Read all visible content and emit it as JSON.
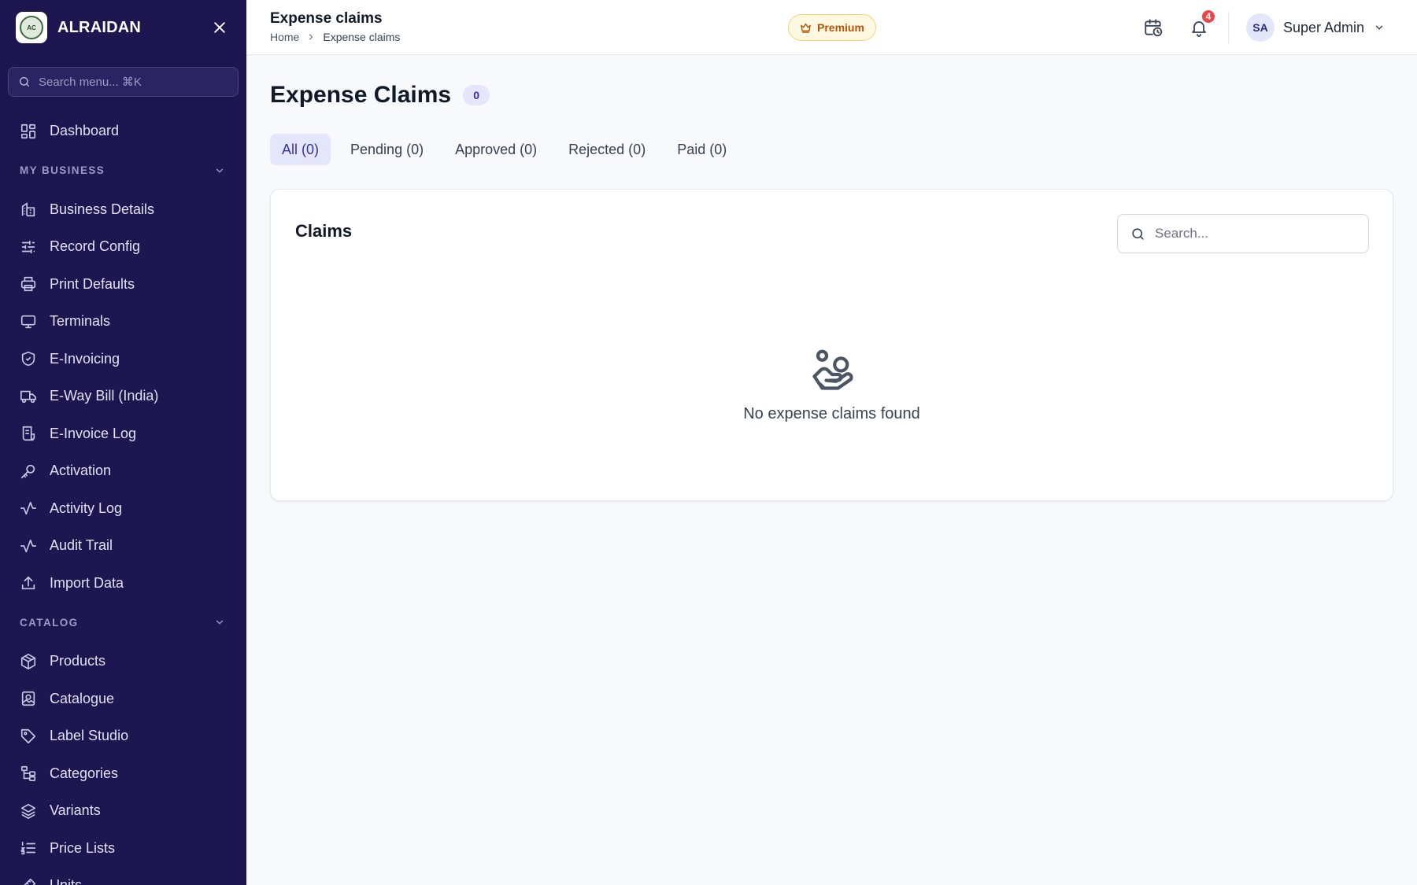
{
  "sidebar": {
    "brand": "ALRAIDAN",
    "logo_text": "AC",
    "search_placeholder": "Search menu... ⌘K",
    "dashboard": {
      "label": "Dashboard",
      "icon": "dashboard-icon"
    },
    "sections": [
      {
        "label": "MY BUSINESS",
        "items": [
          {
            "label": "Business Details",
            "icon": "building-icon"
          },
          {
            "label": "Record Config",
            "icon": "sliders-icon"
          },
          {
            "label": "Print Defaults",
            "icon": "printer-icon"
          },
          {
            "label": "Terminals",
            "icon": "monitor-icon"
          },
          {
            "label": "E-Invoicing",
            "icon": "shield-check-icon"
          },
          {
            "label": "E-Way Bill (India)",
            "icon": "truck-icon"
          },
          {
            "label": "E-Invoice Log",
            "icon": "receipt-icon"
          },
          {
            "label": "Activation",
            "icon": "key-icon"
          },
          {
            "label": "Activity Log",
            "icon": "activity-icon"
          },
          {
            "label": "Audit Trail",
            "icon": "activity-icon"
          },
          {
            "label": "Import Data",
            "icon": "upload-icon"
          }
        ]
      },
      {
        "label": "CATALOG",
        "items": [
          {
            "label": "Products",
            "icon": "box-icon"
          },
          {
            "label": "Catalogue",
            "icon": "image-icon"
          },
          {
            "label": "Label Studio",
            "icon": "tag-icon"
          },
          {
            "label": "Categories",
            "icon": "hierarchy-icon"
          },
          {
            "label": "Variants",
            "icon": "layers-icon"
          },
          {
            "label": "Price Lists",
            "icon": "list-ordered-icon"
          },
          {
            "label": "Units",
            "icon": "ruler-icon"
          }
        ]
      }
    ]
  },
  "topbar": {
    "title": "Expense claims",
    "breadcrumb": {
      "home": "Home",
      "current": "Expense claims"
    },
    "premium_label": "Premium",
    "notification_count": "4",
    "user": {
      "initials": "SA",
      "name": "Super Admin"
    }
  },
  "page": {
    "title": "Expense Claims",
    "count": "0",
    "tabs": [
      "All (0)",
      "Pending (0)",
      "Approved (0)",
      "Rejected (0)",
      "Paid (0)"
    ],
    "active_tab": 0,
    "card": {
      "title": "Claims",
      "search_placeholder": "Search...",
      "empty_message": "No expense claims found"
    }
  },
  "colors": {
    "sidebar_bg": "#1e1650",
    "accent": "#3730a3",
    "accent_soft": "#e4e6fb",
    "premium": "#b45309",
    "badge": "#ef4444"
  }
}
